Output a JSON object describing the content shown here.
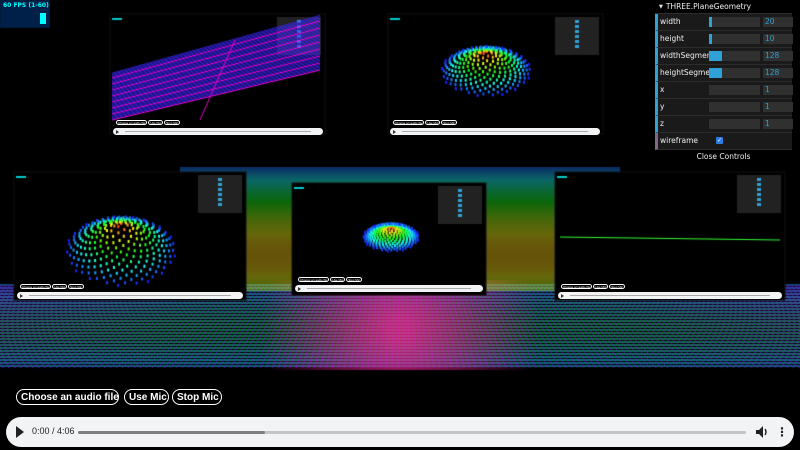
{
  "stats": {
    "fps_label": "60 FPS (1-60)",
    "bar_color": "#00ffff"
  },
  "gui": {
    "title": "THREE.PlaneGeometry",
    "rows": [
      {
        "label": "width",
        "value": "20",
        "fill": 0.05
      },
      {
        "label": "height",
        "value": "10",
        "fill": 0.05
      },
      {
        "label": "widthSegments",
        "value": "128",
        "fill": 0.25
      },
      {
        "label": "heightSegments",
        "value": "128",
        "fill": 0.25
      },
      {
        "label": "x",
        "value": "1"
      },
      {
        "label": "y",
        "value": "1"
      },
      {
        "label": "z",
        "value": "1"
      }
    ],
    "wireframe_label": "wireframe",
    "wireframe_checked": true,
    "close_label": "Close Controls",
    "accent_color": "#2fa1d6"
  },
  "controls": {
    "choose_file_label": "Choose an audio file",
    "use_mic_label": "Use Mic",
    "stop_mic_label": "Stop Mic"
  },
  "player": {
    "time": "0:00 / 4:06",
    "buffered_fraction": 0.28,
    "play_icon": "play-icon",
    "volume_icon": "volume-icon",
    "menu_icon": "more-options-icon"
  },
  "mini_labels": {
    "file": "Choose an audio file",
    "mic": "Use Mic",
    "stop": "Stop Mic"
  }
}
